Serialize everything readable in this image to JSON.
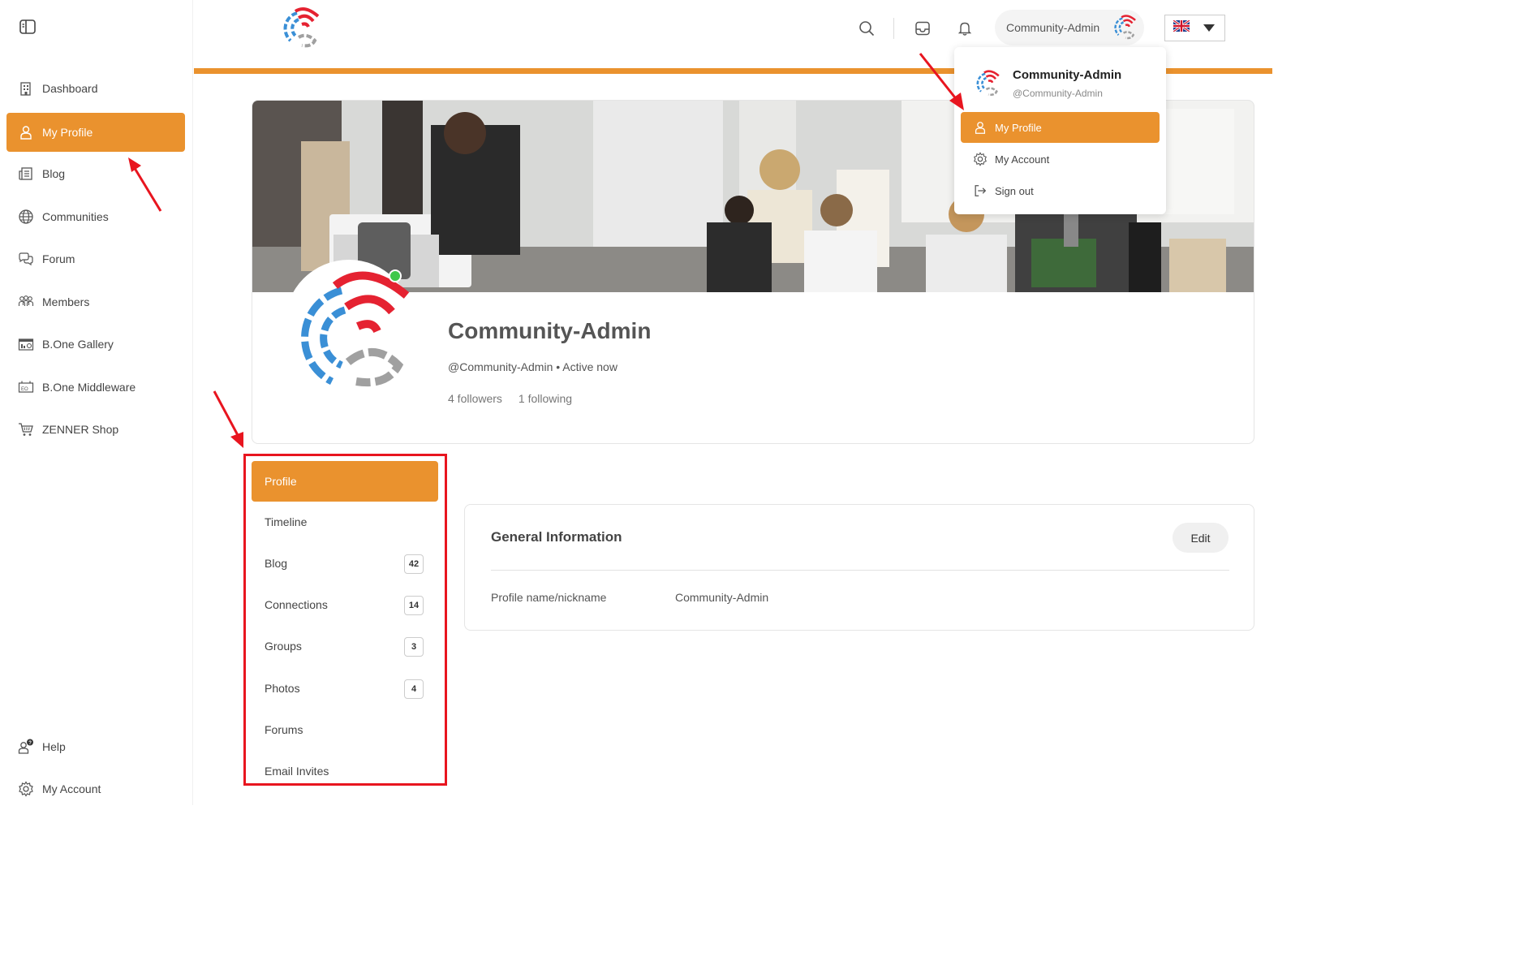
{
  "sidebar": {
    "items": [
      {
        "label": "Dashboard",
        "icon": "building-icon"
      },
      {
        "label": "My Profile",
        "icon": "person-icon"
      },
      {
        "label": "Blog",
        "icon": "newspaper-icon"
      },
      {
        "label": "Communities",
        "icon": "globe-icon"
      },
      {
        "label": "Forum",
        "icon": "chat-icon"
      },
      {
        "label": "Members",
        "icon": "group-icon"
      },
      {
        "label": "B.One Gallery",
        "icon": "gallery-icon"
      },
      {
        "label": "B.One Middleware",
        "icon": "middleware-icon"
      },
      {
        "label": "ZENNER Shop",
        "icon": "cart-icon"
      }
    ],
    "bottom": [
      {
        "label": "Help",
        "icon": "help-icon"
      },
      {
        "label": "My Account",
        "icon": "gear-icon"
      }
    ]
  },
  "header": {
    "user_name": "Community-Admin",
    "language": "English (UK flag)"
  },
  "dropdown": {
    "name": "Community-Admin",
    "handle": "@Community-Admin",
    "items": [
      {
        "label": "My Profile",
        "icon": "person-icon"
      },
      {
        "label": "My Account",
        "icon": "gear-icon"
      },
      {
        "label": "Sign out",
        "icon": "sign-out-icon"
      }
    ]
  },
  "profile": {
    "name": "Community-Admin",
    "subline": "@Community-Admin • Active now",
    "followers": "4 followers",
    "following": "1 following"
  },
  "profile_nav": [
    {
      "label": "Profile",
      "count": ""
    },
    {
      "label": "Timeline",
      "count": ""
    },
    {
      "label": "Blog",
      "count": "42"
    },
    {
      "label": "Connections",
      "count": "14"
    },
    {
      "label": "Groups",
      "count": "3"
    },
    {
      "label": "Photos",
      "count": "4"
    },
    {
      "label": "Forums",
      "count": ""
    },
    {
      "label": "Email Invites",
      "count": ""
    }
  ],
  "general_info": {
    "title": "General Information",
    "edit_label": "Edit",
    "field_label": "Profile name/nickname",
    "field_value": "Community-Admin"
  },
  "colors": {
    "accent": "#ea922e",
    "highlight_red": "#e8151f",
    "logo_blue": "#3a8fd6",
    "logo_red": "#e52231",
    "logo_gray": "#a0a0a0"
  }
}
